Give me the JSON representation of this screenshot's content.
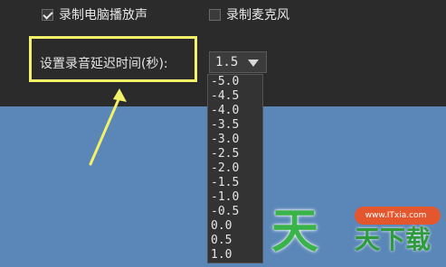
{
  "options": {
    "record_system_sound_label": "录制电脑播放声",
    "record_system_sound_checked": true,
    "record_microphone_label": "录制麦克风",
    "record_microphone_checked": false
  },
  "delay": {
    "label": "设置录音延迟时间(秒):",
    "selected": "1.5",
    "list": [
      "-5.0",
      "-4.5",
      "-4.0",
      "-3.5",
      "-3.0",
      "-2.5",
      "-2.0",
      "-1.5",
      "-1.0",
      "-0.5",
      "0.0",
      "0.5",
      "1.0"
    ]
  },
  "annotation": {
    "highlight_color": "#f3f06a",
    "arrow_color": "#f3f06a"
  },
  "watermark": {
    "main": "天",
    "sub": "天下载",
    "url": "www.ITxia.com",
    "brand_color": "#3ab44a",
    "accent_color": "#e4572e"
  }
}
